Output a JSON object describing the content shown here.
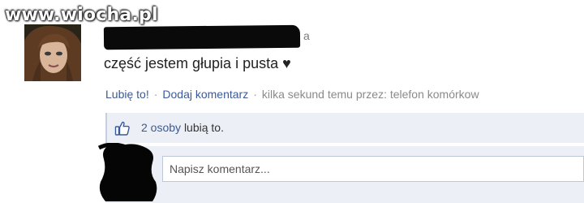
{
  "watermark": "www.wiocha.pl",
  "post": {
    "author_tail": "a",
    "status_text": "część jestem głupia i pusta ♥"
  },
  "actions": {
    "like_label": "Lubię to!",
    "separator": "·",
    "comment_label": "Dodaj komentarz",
    "meta_text": "kilka sekund temu przez: telefon komórkow"
  },
  "likes": {
    "icon": "thumbs-up-icon",
    "count_label": "2 osoby",
    "suffix": "lubią to."
  },
  "comment": {
    "placeholder": "Napisz komentarz..."
  },
  "colors": {
    "link": "#3b5998",
    "likes_bg": "#eceff5"
  }
}
